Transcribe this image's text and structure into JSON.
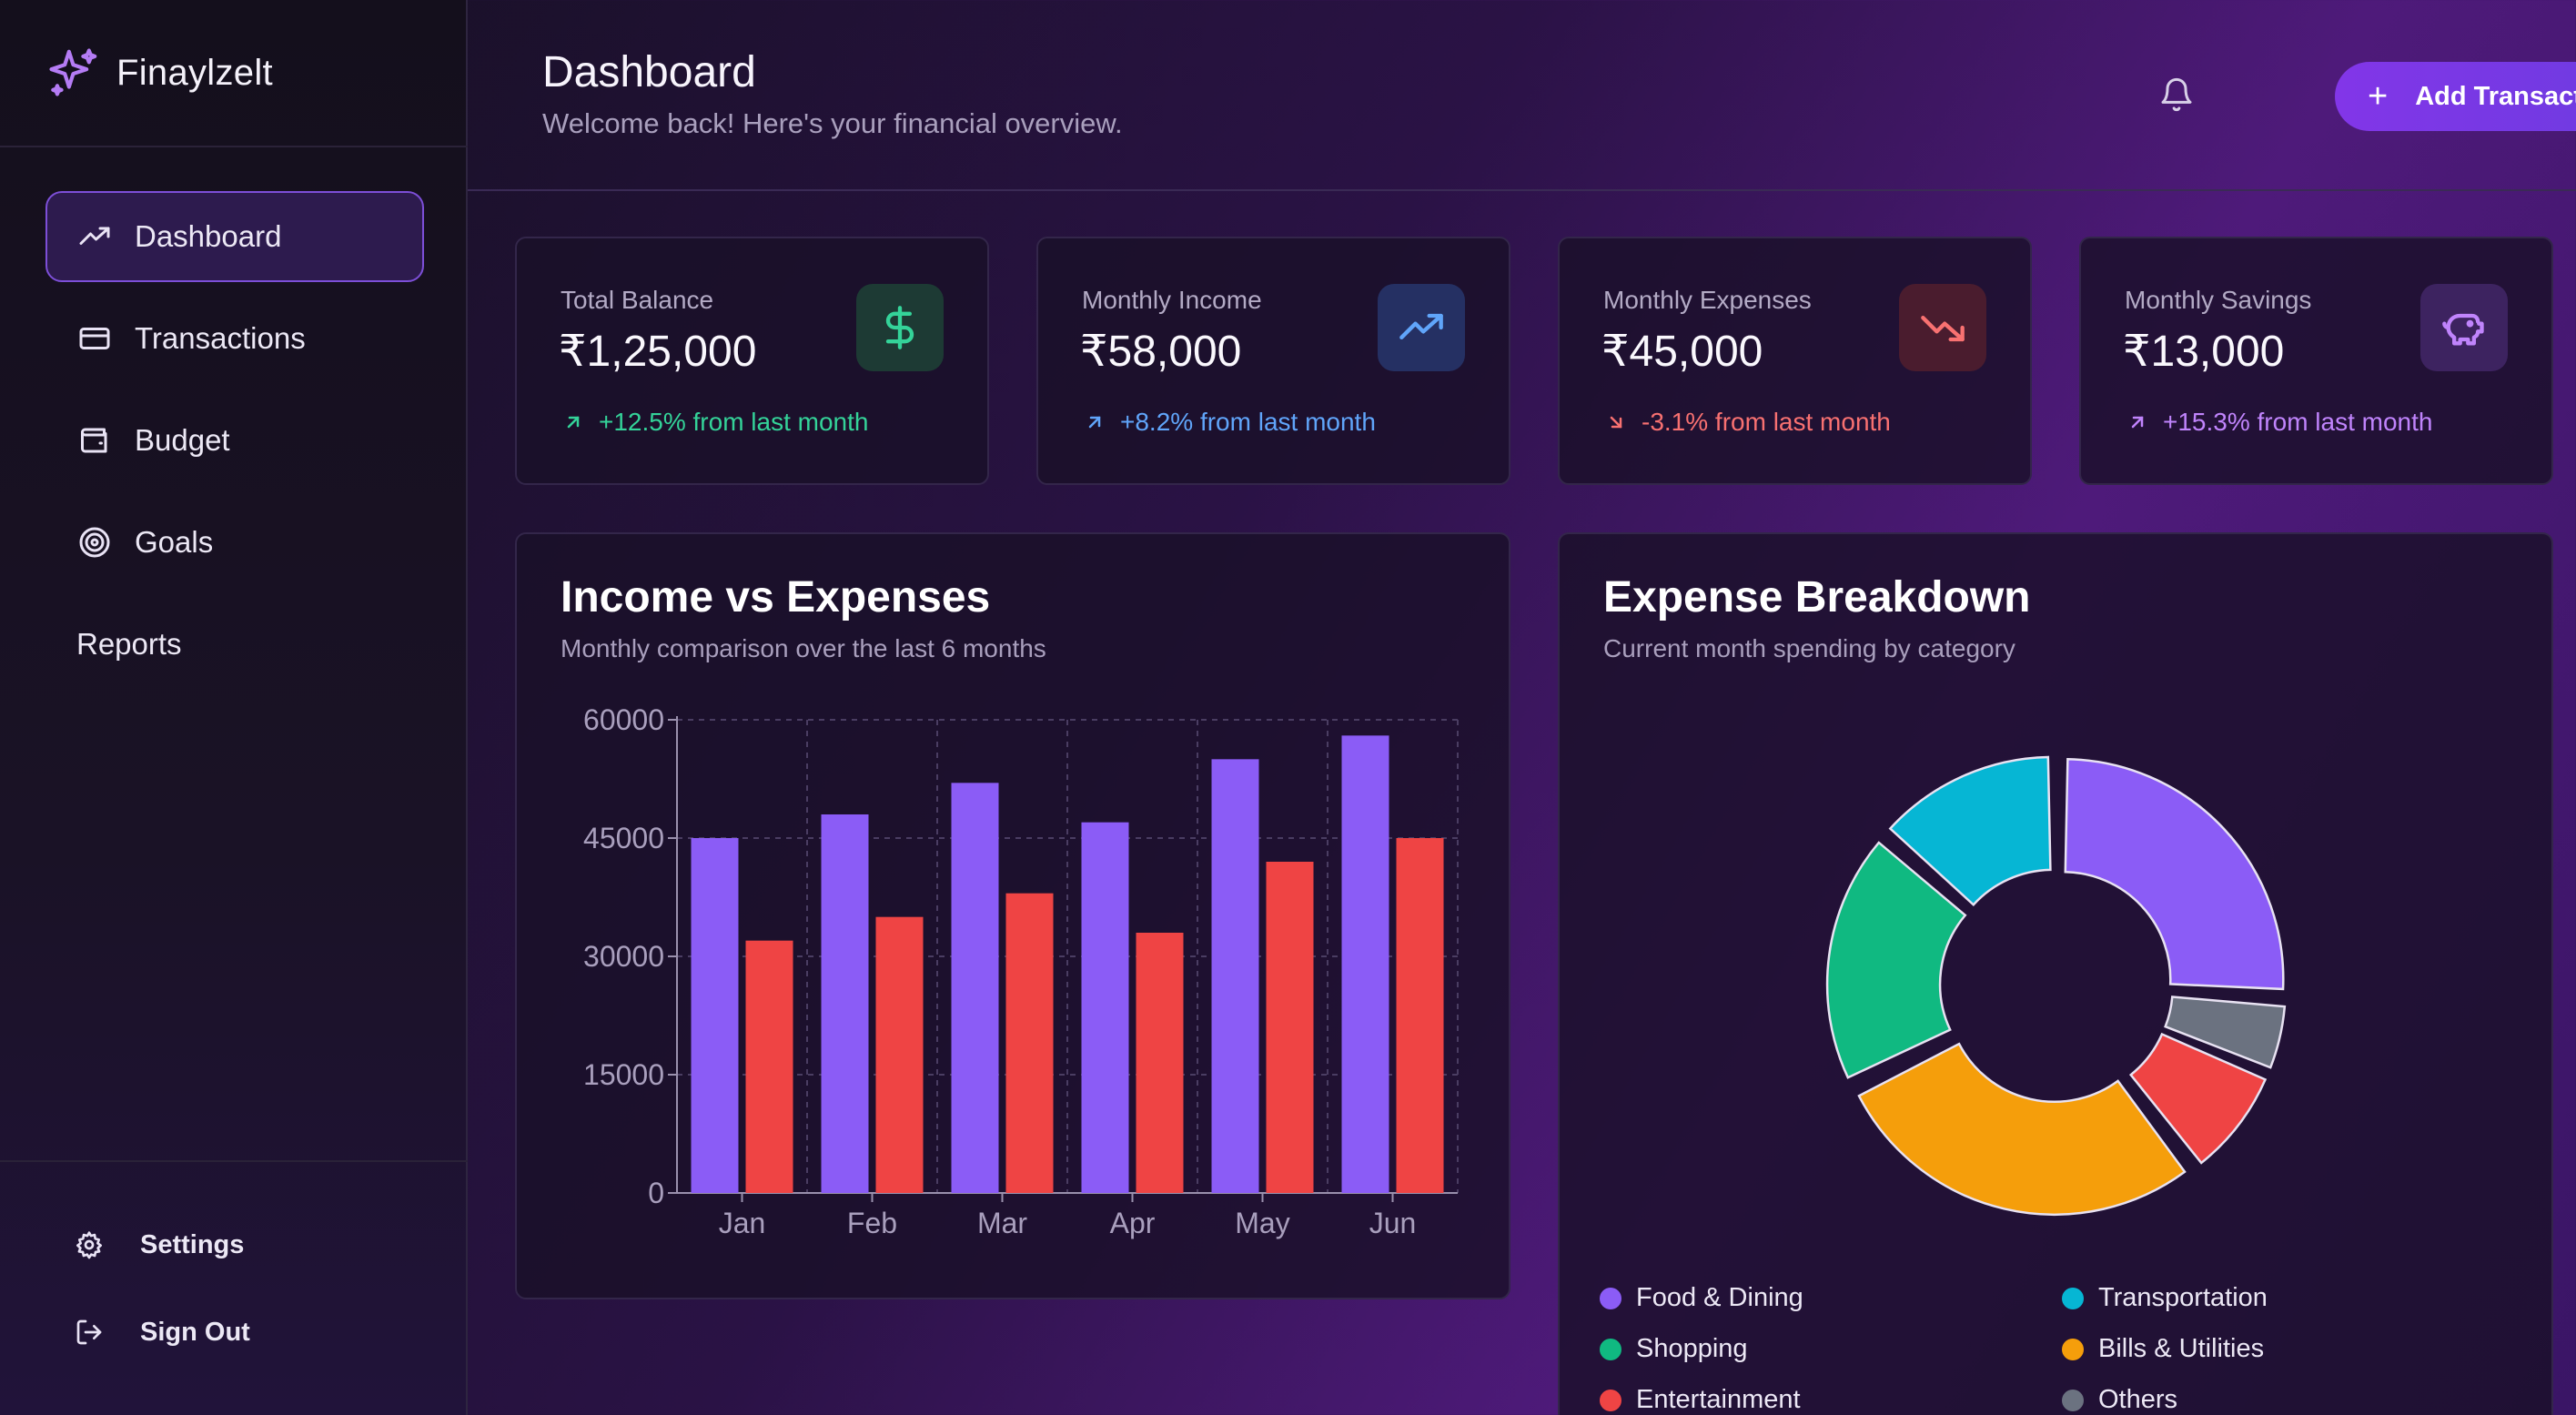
{
  "app": {
    "name": "Finaylzelt"
  },
  "sidebar": {
    "items": [
      {
        "label": "Dashboard",
        "icon": "trending-up-icon",
        "active": true
      },
      {
        "label": "Transactions",
        "icon": "credit-card-icon",
        "active": false
      },
      {
        "label": "Budget",
        "icon": "wallet-icon",
        "active": false
      },
      {
        "label": "Goals",
        "icon": "target-icon",
        "active": false
      },
      {
        "label": "Reports",
        "icon": "",
        "active": false
      }
    ],
    "footer": {
      "settings": "Settings",
      "sign_out": "Sign Out"
    }
  },
  "header": {
    "title": "Dashboard",
    "subtitle": "Welcome back! Here's your financial overview.",
    "add_button": "Add Transaction"
  },
  "stats": [
    {
      "label": "Total Balance",
      "value": "₹1,25,000",
      "change": "+12.5% from last month",
      "trend": "up",
      "icon": "dollar-icon",
      "color": "#34d399"
    },
    {
      "label": "Monthly Income",
      "value": "₹58,000",
      "change": "+8.2% from last month",
      "trend": "up",
      "icon": "trending-up-icon",
      "color": "#60a5fa"
    },
    {
      "label": "Monthly Expenses",
      "value": "₹45,000",
      "change": "-3.1% from last month",
      "trend": "down",
      "icon": "trending-down-icon",
      "color": "#f87171"
    },
    {
      "label": "Monthly Savings",
      "value": "₹13,000",
      "change": "+15.3% from last month",
      "trend": "up",
      "icon": "piggy-bank-icon",
      "color": "#c084fc"
    }
  ],
  "income_panel": {
    "title": "Income vs Expenses",
    "subtitle": "Monthly comparison over the last 6 months"
  },
  "expense_panel": {
    "title": "Expense Breakdown",
    "subtitle": "Current month spending by category"
  },
  "chart_data": [
    {
      "type": "bar",
      "categories": [
        "Jan",
        "Feb",
        "Mar",
        "Apr",
        "May",
        "Jun"
      ],
      "series": [
        {
          "values": [
            45000,
            48000,
            52000,
            47000,
            55000,
            58000
          ],
          "color": "#8b5cf6"
        },
        {
          "values": [
            32000,
            35000,
            38000,
            33000,
            42000,
            45000
          ],
          "color": "#ef4444"
        }
      ],
      "yticks": [
        "0",
        "15000",
        "30000",
        "45000",
        "60000"
      ],
      "ylim": [
        0,
        60000
      ],
      "grid": true
    },
    {
      "type": "pie",
      "donut": true,
      "slices": [
        {
          "label": "Food & Dining",
          "value": 25,
          "color": "#8b5cf6"
        },
        {
          "label": "Others",
          "value": 5,
          "color": "#6b7280"
        },
        {
          "label": "Entertainment",
          "value": 8,
          "color": "#ef4444"
        },
        {
          "label": "Bills & Utilities",
          "value": 27,
          "color": "#f59e0b"
        },
        {
          "label": "Shopping",
          "value": 18,
          "color": "#10b981"
        },
        {
          "label": "Transportation",
          "value": 13,
          "color": "#06b6d4"
        }
      ],
      "legend": [
        {
          "label": "Food & Dining",
          "color": "#8b5cf6"
        },
        {
          "label": "Transportation",
          "color": "#06b6d4"
        },
        {
          "label": "Shopping",
          "color": "#10b981"
        },
        {
          "label": "Bills & Utilities",
          "color": "#f59e0b"
        },
        {
          "label": "Entertainment",
          "color": "#ef4444"
        },
        {
          "label": "Others",
          "color": "#6b7280"
        }
      ],
      "legend_position": "bottom"
    }
  ]
}
